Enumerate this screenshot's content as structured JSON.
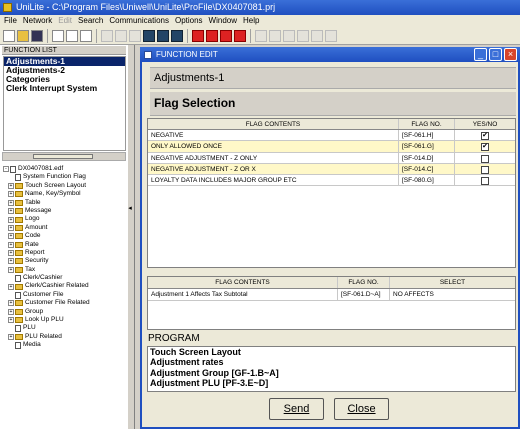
{
  "app": {
    "title": "UniLite - C:\\Program Files\\Uniwell\\UniLite\\ProFile\\DX0407081.prj"
  },
  "menu": [
    "File",
    "Network",
    "Edit",
    "Search",
    "Communications",
    "Options",
    "Window",
    "Help"
  ],
  "function_list": {
    "header": "FUNCTION LIST",
    "items": [
      "Adjustments-1",
      "Adjustments-2",
      "Categories",
      "Clerk Interrupt System"
    ],
    "selected": "Adjustments-1"
  },
  "tree": {
    "root": "DX0407081.edf",
    "items": [
      "System Function Flag",
      "Touch Screen Layout",
      "Name, Key/Symbol",
      "Table",
      "Message",
      "Logo",
      "Amount",
      "Code",
      "Rate",
      "Report",
      "Security",
      "Tax",
      "Clerk/Cashier",
      "Clerk/Cashier Related",
      "Customer File",
      "Customer File Related",
      "Group",
      "Look Up PLU",
      "PLU",
      "PLU Related",
      "Media"
    ]
  },
  "window": {
    "title": "FUNCTION EDIT",
    "subheader": "Adjustments-1",
    "section": "Flag Selection"
  },
  "flag_table": {
    "headers": [
      "FLAG CONTENTS",
      "FLAG NO.",
      "YES/NO"
    ],
    "rows": [
      {
        "content": "NEGATIVE",
        "flag": "[SF-061.H]",
        "checked": true
      },
      {
        "content": "ONLY ALLOWED ONCE",
        "flag": "[SF-061.G]",
        "checked": true
      },
      {
        "content": "NEGATIVE ADJUSTMENT - Z ONLY",
        "flag": "[SF-014.D]",
        "checked": false
      },
      {
        "content": "NEGATIVE ADJUSTMENT - Z OR X",
        "flag": "[SF-014.C]",
        "checked": false
      },
      {
        "content": "LOYALTY DATA INCLUDES MAJOR GROUP ETC",
        "flag": "[SF-080.G]",
        "checked": false
      }
    ]
  },
  "select_table": {
    "headers": [
      "FLAG CONTENTS",
      "FLAG NO.",
      "SELECT"
    ],
    "rows": [
      {
        "content": "Adjustment 1 Affects Tax Subtotal",
        "flag": "[SF-061.D~A]",
        "select": "NO AFFECTS"
      }
    ]
  },
  "program": {
    "label": "PROGRAM",
    "lines": [
      "Touch Screen Layout",
      "Adjustment rates",
      "Adjustment Group [GF-1.B~A]",
      "Adjustment PLU [PF-3.E~D]"
    ]
  },
  "buttons": {
    "send": "Send",
    "close": "Close"
  },
  "colors": {
    "title_blue": "#1f4fc0",
    "selection": "#0a246a",
    "highlight_row": "#fff8c8"
  }
}
